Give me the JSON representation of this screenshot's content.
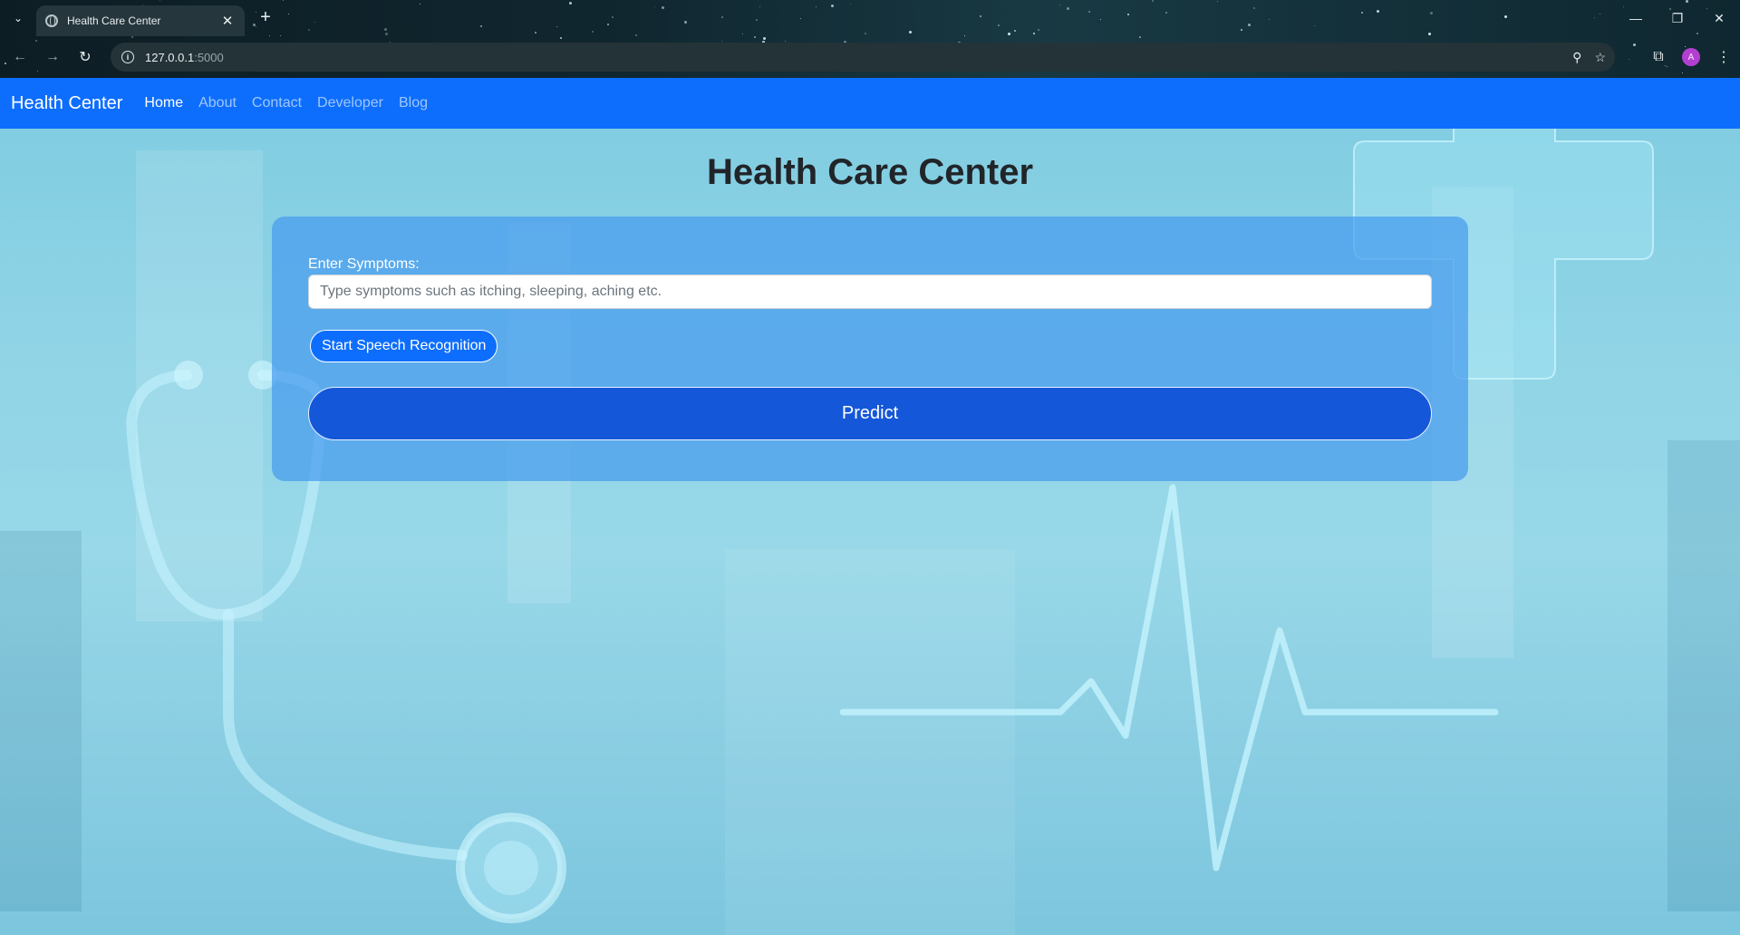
{
  "browser": {
    "tab_title": "Health Care Center",
    "new_tab_symbol": "+",
    "url_host": "127.0.0.1",
    "url_port": ":5000",
    "profile_initial": "A"
  },
  "navbar": {
    "brand": "Health Center",
    "links": [
      "Home",
      "About",
      "Contact",
      "Developer",
      "Blog"
    ],
    "active": "Home"
  },
  "main": {
    "title": "Health Care Center",
    "form": {
      "label": "Enter Symptoms:",
      "input_value": "",
      "input_placeholder": "Type symptoms such as itching, sleeping, aching etc.",
      "speech_button": "Start Speech Recognition",
      "predict_button": "Predict"
    }
  },
  "colors": {
    "navbar": "#0d6efd",
    "predict_button": "#1557d9",
    "card": "#469bee"
  },
  "icons": [
    "tab-list-icon",
    "globe-icon",
    "close-icon",
    "back-icon",
    "forward-icon",
    "reload-icon",
    "info-icon",
    "zoom-icon",
    "star-icon",
    "extensions-icon",
    "menu-icon",
    "minimize-icon",
    "restore-icon",
    "window-close-icon"
  ]
}
